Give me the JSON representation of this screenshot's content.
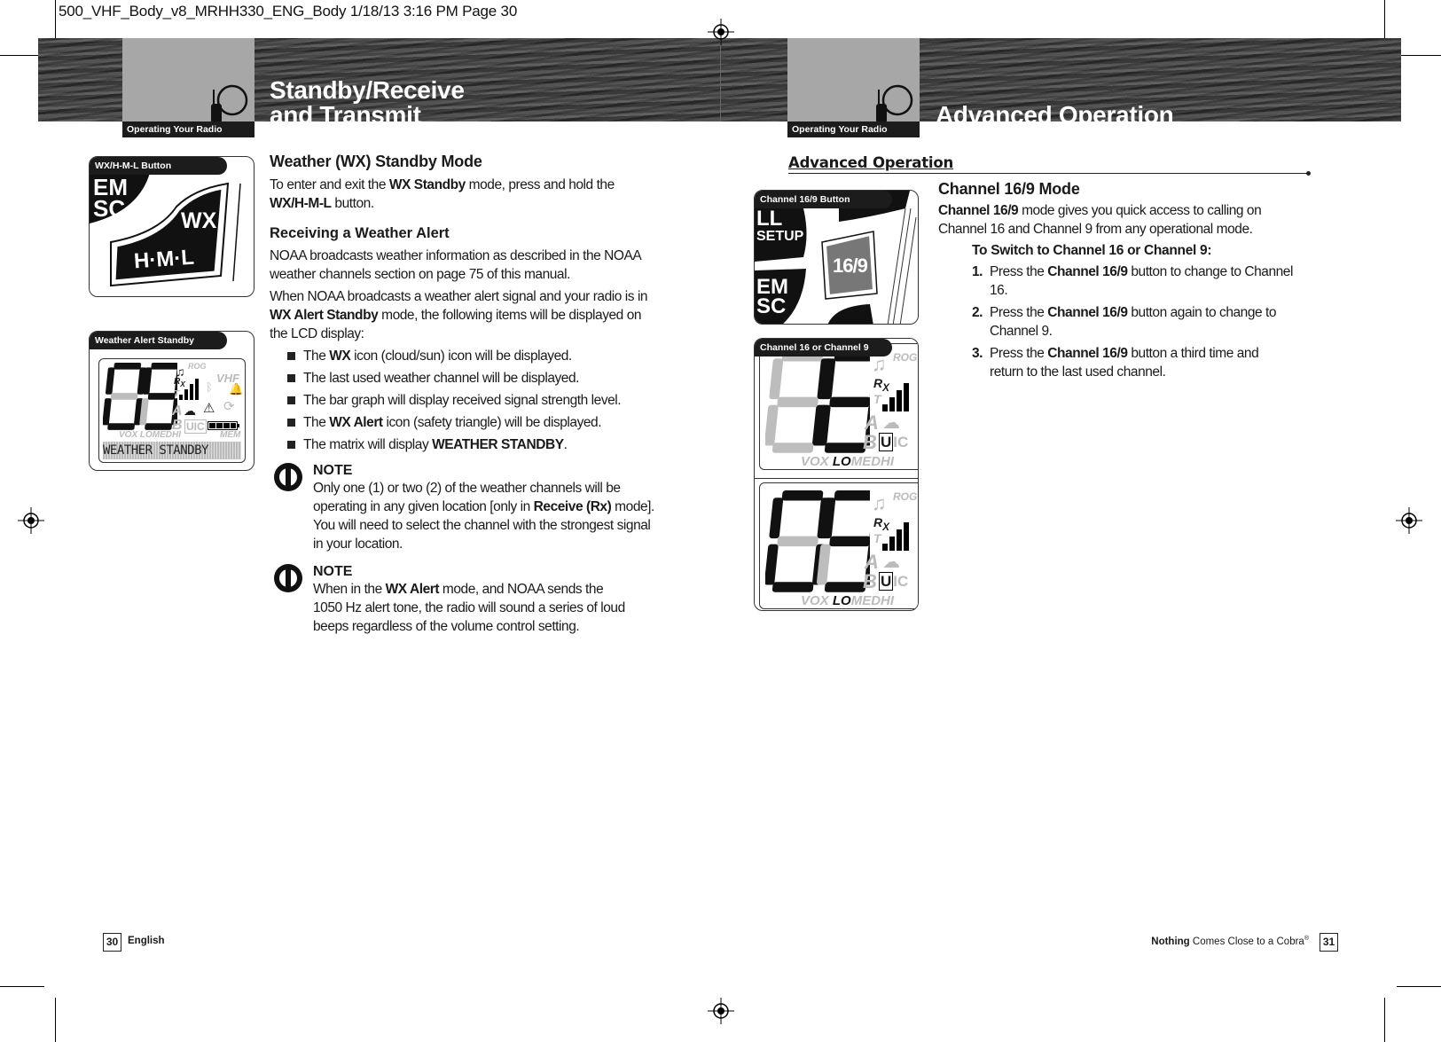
{
  "slug": "500_VHF_Body_v8_MRHH330_ENG_Body  1/18/13  3:16 PM  Page 30",
  "left": {
    "section_label": "Operating Your Radio",
    "title_line1": "Standby/Receive",
    "title_line2": "and Transmit",
    "fig1": {
      "tag": "WX/H-M-L Button",
      "btn1": "EM",
      "btn1b": "SC",
      "wx": "WX",
      "hml": "H·M·L"
    },
    "fig2": {
      "tag": "Weather Alert Standby",
      "channel": "09",
      "rog": "ROG",
      "vhf": "VHF",
      "r": "R",
      "x": "X",
      "t": "T",
      "a": "A",
      "b": "B",
      "u": "U",
      "i": "I",
      "c": "C",
      "vox": "VOX",
      "lo": "LO",
      "med": "MED",
      "hi": "HI",
      "mem": "MEM",
      "matrix": "WEATHER STANDBY"
    },
    "heading": "Weather (WX) Standby Mode",
    "p1": [
      {
        "t": "To enter and exit the "
      },
      {
        "t": "WX Standby",
        "b": 1
      },
      {
        "t": " mode, press and hold the "
      },
      {
        "t": "WX/H-M-L",
        "b": 1
      },
      {
        "t": " button."
      }
    ],
    "sub": "Receiving a Weather Alert",
    "p2": [
      {
        "t": "NOAA broadcasts weather information as described in the NOAA weather channels section on page 75 of this manual."
      }
    ],
    "p3": [
      {
        "t": "When NOAA broadcasts a weather alert signal and your radio is in "
      },
      {
        "t": "WX Alert Standby",
        "b": 1
      },
      {
        "t": " mode, the following items will be displayed on the LCD display:"
      }
    ],
    "bullets": [
      [
        {
          "t": "The "
        },
        {
          "t": "WX",
          "b": 1
        },
        {
          "t": " icon (cloud/sun) icon will be displayed."
        }
      ],
      [
        {
          "t": "The last used weather channel will be displayed."
        }
      ],
      [
        {
          "t": "The bar graph will display received signal strength level."
        }
      ],
      [
        {
          "t": "The "
        },
        {
          "t": "WX Alert",
          "b": 1
        },
        {
          "t": " icon (safety triangle) will be displayed."
        }
      ],
      [
        {
          "t": "The matrix will display "
        },
        {
          "t": "WEATHER STANDBY",
          "b": 1
        },
        {
          "t": "."
        }
      ]
    ],
    "note1": {
      "label": "NOTE",
      "text": [
        {
          "t": "Only one (1) or two (2) of the weather channels will be operating in any given location [only in "
        },
        {
          "t": "Receive (Rx)",
          "b": 1
        },
        {
          "t": " mode]. You will need to select the channel with the strongest signal in your location."
        }
      ]
    },
    "note2": {
      "label": "NOTE",
      "text": [
        {
          "t": "When in the "
        },
        {
          "t": "WX Alert",
          "b": 1
        },
        {
          "t": " mode, and NOAA sends the 1050 Hz alert tone, the radio will sound a series of loud beeps regardless of the volume control setting."
        }
      ]
    },
    "page_number": "30",
    "footer": "English"
  },
  "right": {
    "section_label": "Operating Your Radio",
    "title": "Advanced Operation",
    "section_header": "Advanced Operation",
    "fig1": {
      "tag": "Channel 16/9 Button",
      "btn1": "LL",
      "btn1b": "SETUP",
      "btn2": "EM",
      "btn2b": "SC",
      "btn169": "16/9"
    },
    "fig2": {
      "tag": "Channel 16 or Channel 9",
      "channel_a": "16",
      "channel_b": "09",
      "rog": "ROG",
      "r": "R",
      "x": "X",
      "t": "T",
      "a": "A",
      "b": "B",
      "u": "U",
      "i": "I",
      "c": "C",
      "vox": "VOX",
      "lo": "LO",
      "med": "MED",
      "hi": "HI"
    },
    "heading": "Channel 16/9 Mode",
    "p1": [
      {
        "t": "Channel 16/9",
        "b": 1
      },
      {
        "t": " mode gives you quick access to calling on Channel 16 and Channel 9 from any operational mode."
      }
    ],
    "sub": "To Switch to Channel 16 or Channel 9:",
    "steps": [
      {
        "n": "1.",
        "text": [
          {
            "t": "Press the "
          },
          {
            "t": "Channel 16/9",
            "b": 1
          },
          {
            "t": " button to change to Channel 16."
          }
        ]
      },
      {
        "n": "2.",
        "text": [
          {
            "t": "Press the "
          },
          {
            "t": "Channel 16/9",
            "b": 1
          },
          {
            "t": " button again to change to Channel 9."
          }
        ]
      },
      {
        "n": "3.",
        "text": [
          {
            "t": "Press the "
          },
          {
            "t": "Channel 16/9",
            "b": 1
          },
          {
            "t": " button a third time and return to the last used channel."
          }
        ]
      }
    ],
    "footer_bold": "Nothing",
    "footer_rest": " Comes Close to a Cobra",
    "footer_reg": "®",
    "page_number": "31"
  }
}
